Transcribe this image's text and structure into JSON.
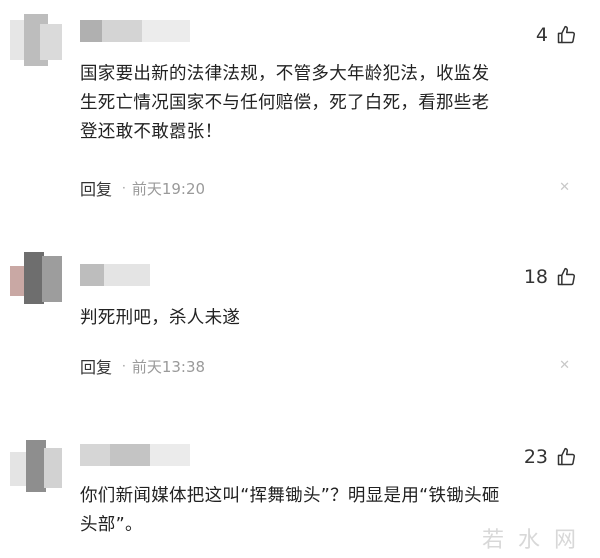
{
  "comments": [
    {
      "likes": "4",
      "text_lines": [
        "国家要出新的法律法规，不管多大年龄犯法，收监发",
        "生死亡情况国家不与任何赔偿，死了白死，看那些老",
        "登还敢不敢嚣张！"
      ],
      "reply_label": "回复",
      "separator": "·",
      "time": "前天19:20"
    },
    {
      "likes": "18",
      "text_lines": [
        "判死刑吧，杀人未遂"
      ],
      "reply_label": "回复",
      "separator": "·",
      "time": "前天13:38"
    },
    {
      "likes": "23",
      "text_lines": [
        "你们新闻媒体把这叫“挥舞锄头”？明显是用“铁锄头砸",
        "头部”。"
      ]
    }
  ],
  "watermark": "若水网",
  "icons": {
    "like": "thumbs-up-icon",
    "close": "close-icon"
  },
  "colors": {
    "text": "#222222",
    "meta": "#9a9a9a",
    "divider": "#eeeeee"
  }
}
